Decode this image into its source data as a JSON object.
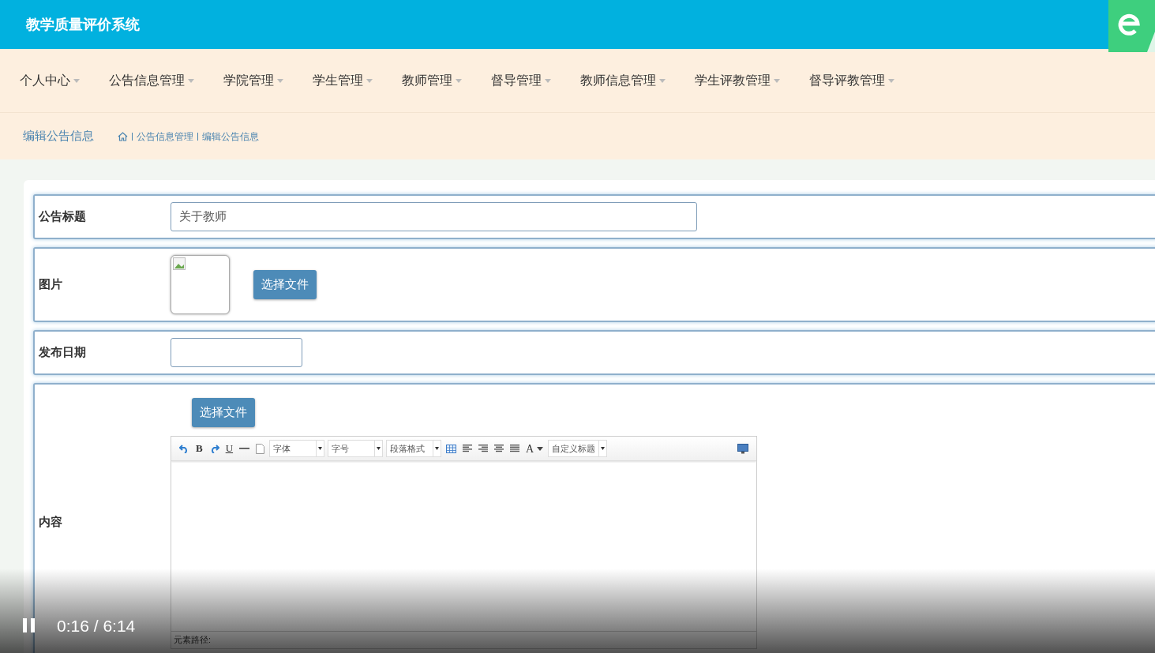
{
  "header": {
    "title": "教学质量评价系统"
  },
  "nav": [
    {
      "label": "个人中心"
    },
    {
      "label": "公告信息管理"
    },
    {
      "label": "学院管理"
    },
    {
      "label": "学生管理"
    },
    {
      "label": "教师管理"
    },
    {
      "label": "督导管理"
    },
    {
      "label": "教师信息管理"
    },
    {
      "label": "学生评教管理"
    },
    {
      "label": "督导评教管理"
    }
  ],
  "breadcrumb": {
    "page_title": "编辑公告信息",
    "path": [
      "公告信息管理",
      "编辑公告信息"
    ]
  },
  "form": {
    "rows": [
      {
        "kind": "text",
        "label": "公告标题",
        "value": "关于教师"
      },
      {
        "kind": "image",
        "label": "图片",
        "button": "选择文件"
      },
      {
        "kind": "date",
        "label": "发布日期"
      },
      {
        "kind": "editor",
        "label": "内容",
        "button": "选择文件",
        "status": "元素路径:",
        "toolbar": [
          {
            "kind": "undo"
          },
          {
            "kind": "bold",
            "label": "B"
          },
          {
            "kind": "redo"
          },
          {
            "kind": "underline",
            "label": "U"
          },
          {
            "kind": "rule"
          },
          {
            "kind": "page"
          },
          {
            "kind": "select",
            "label": "字体"
          },
          {
            "kind": "select",
            "label": "字号"
          },
          {
            "kind": "select",
            "label": "段落格式"
          },
          {
            "kind": "table"
          },
          {
            "kind": "alignleft"
          },
          {
            "kind": "alignright"
          },
          {
            "kind": "aligncenter"
          },
          {
            "kind": "justify"
          },
          {
            "kind": "color",
            "label": "A"
          },
          {
            "kind": "select",
            "label": "自定义标题"
          },
          {
            "kind": "fullscreen"
          }
        ]
      }
    ]
  },
  "player": {
    "playing": true,
    "time": "0:16 / 6:14"
  }
}
